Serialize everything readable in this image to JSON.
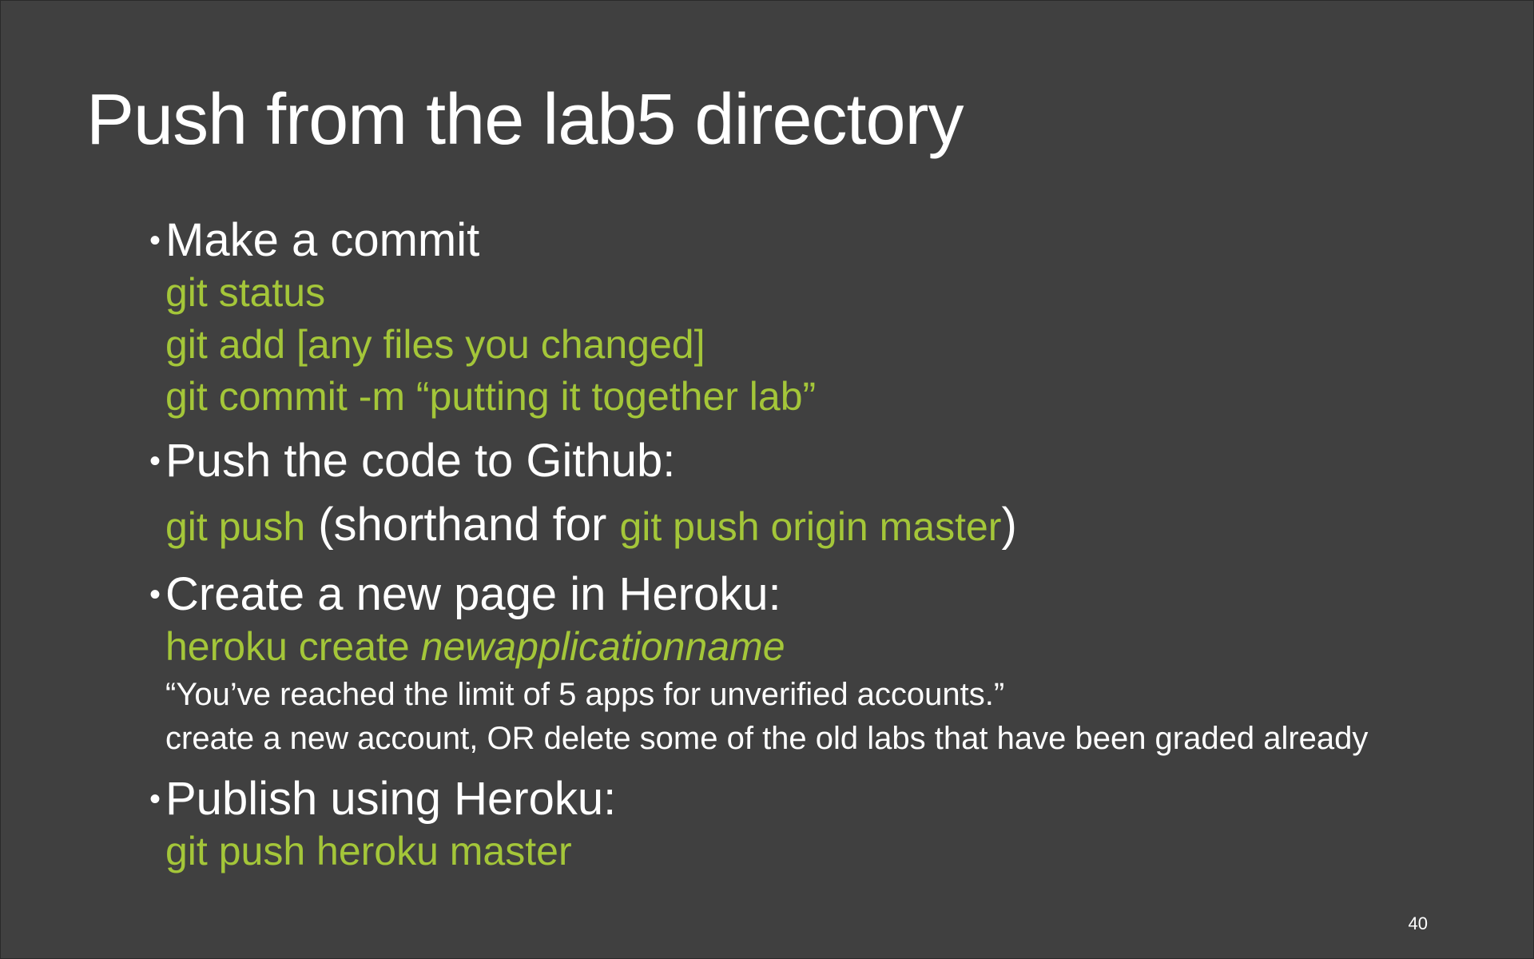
{
  "slide": {
    "title": "Push from the lab5 directory",
    "page_number": "40",
    "sections": {
      "commit": {
        "bullet": "Make a commit",
        "lines": [
          "git status",
          "git add [any files you changed]",
          "git commit -m “putting it together lab”"
        ]
      },
      "push": {
        "bullet": "Push the code to Github:",
        "code1": "git push",
        "text1": " (shorthand for ",
        "code2": "git push origin master",
        "text2": ")"
      },
      "heroku_create": {
        "bullet": "Create a new page in Heroku:",
        "code": "heroku create ",
        "code_italic": "newapplicationname",
        "note1": "“You’ve reached the limit of 5 apps for unverified accounts.”",
        "note2": "create a new account, OR delete some of the old labs that have been graded already"
      },
      "publish": {
        "bullet": "Publish using Heroku:",
        "code": "git push heroku master"
      }
    },
    "colors": {
      "background": "#404040",
      "text": "#ffffff",
      "code": "#a4c639"
    }
  }
}
